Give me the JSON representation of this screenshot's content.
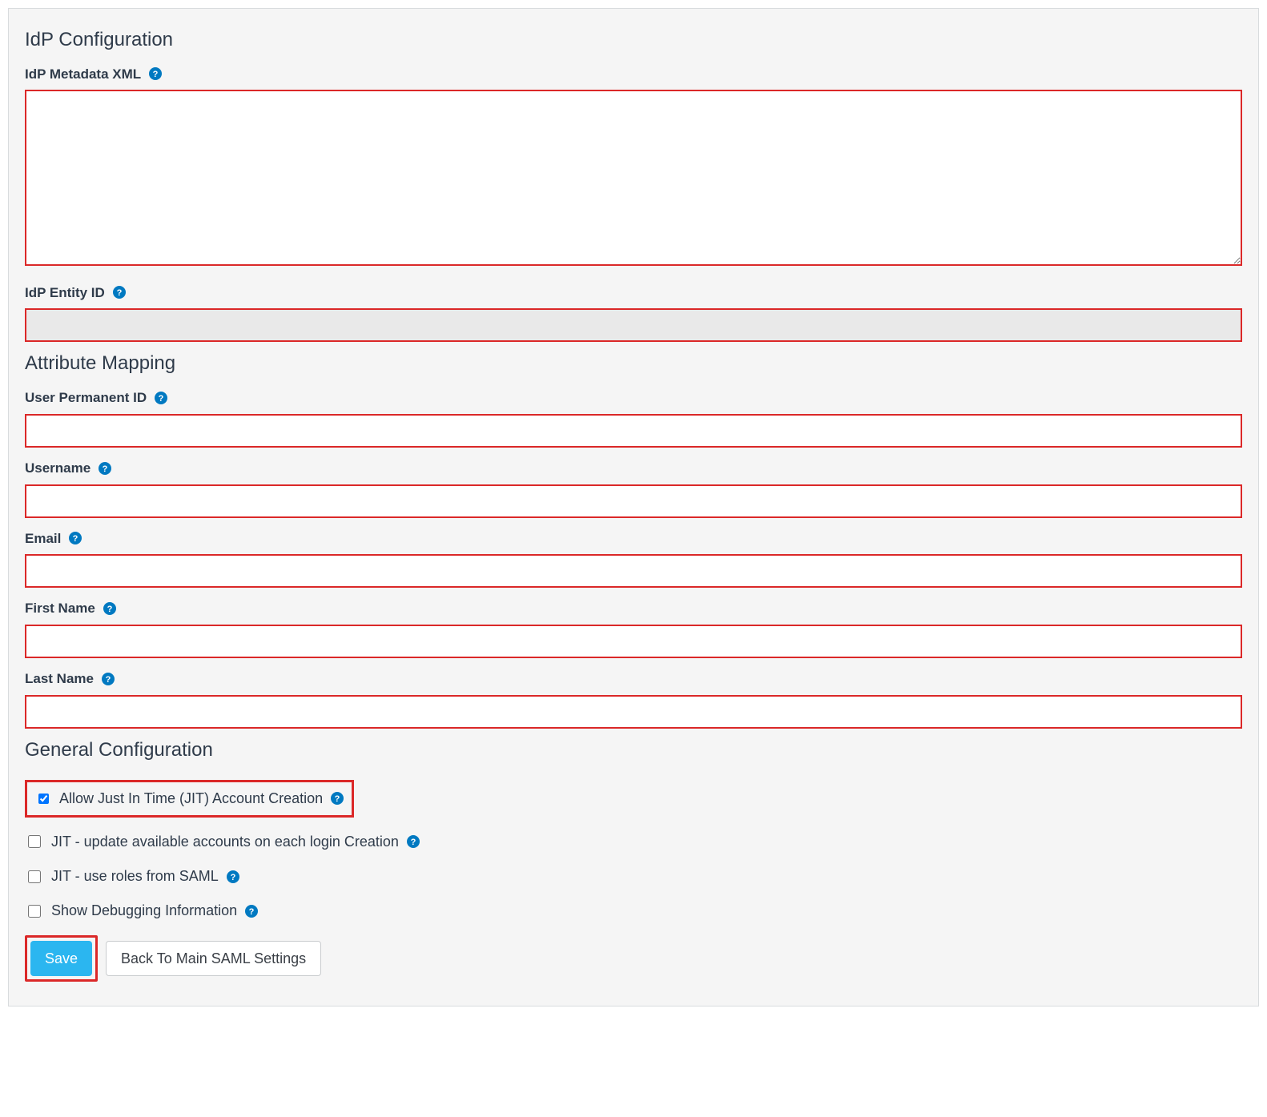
{
  "sections": {
    "idp_config_title": "IdP Configuration",
    "attribute_mapping_title": "Attribute Mapping",
    "general_config_title": "General Configuration"
  },
  "idp": {
    "metadata_label": "IdP Metadata XML",
    "metadata_value": "",
    "entity_id_label": "IdP Entity ID",
    "entity_id_value": ""
  },
  "attr": {
    "permanent_id_label": "User Permanent ID",
    "permanent_id_value": "",
    "username_label": "Username",
    "username_value": "",
    "email_label": "Email",
    "email_value": "",
    "first_name_label": "First Name",
    "first_name_value": "",
    "last_name_label": "Last Name",
    "last_name_value": ""
  },
  "general": {
    "jit_allow_label": "Allow Just In Time (JIT) Account Creation",
    "jit_allow_checked": true,
    "jit_update_label": "JIT - update available accounts on each login Creation",
    "jit_update_checked": false,
    "jit_roles_label": "JIT - use roles from SAML",
    "jit_roles_checked": false,
    "debug_label": "Show Debugging Information",
    "debug_checked": false
  },
  "buttons": {
    "save": "Save",
    "back": "Back To Main SAML Settings"
  },
  "icons": {
    "help": "help-circle"
  }
}
